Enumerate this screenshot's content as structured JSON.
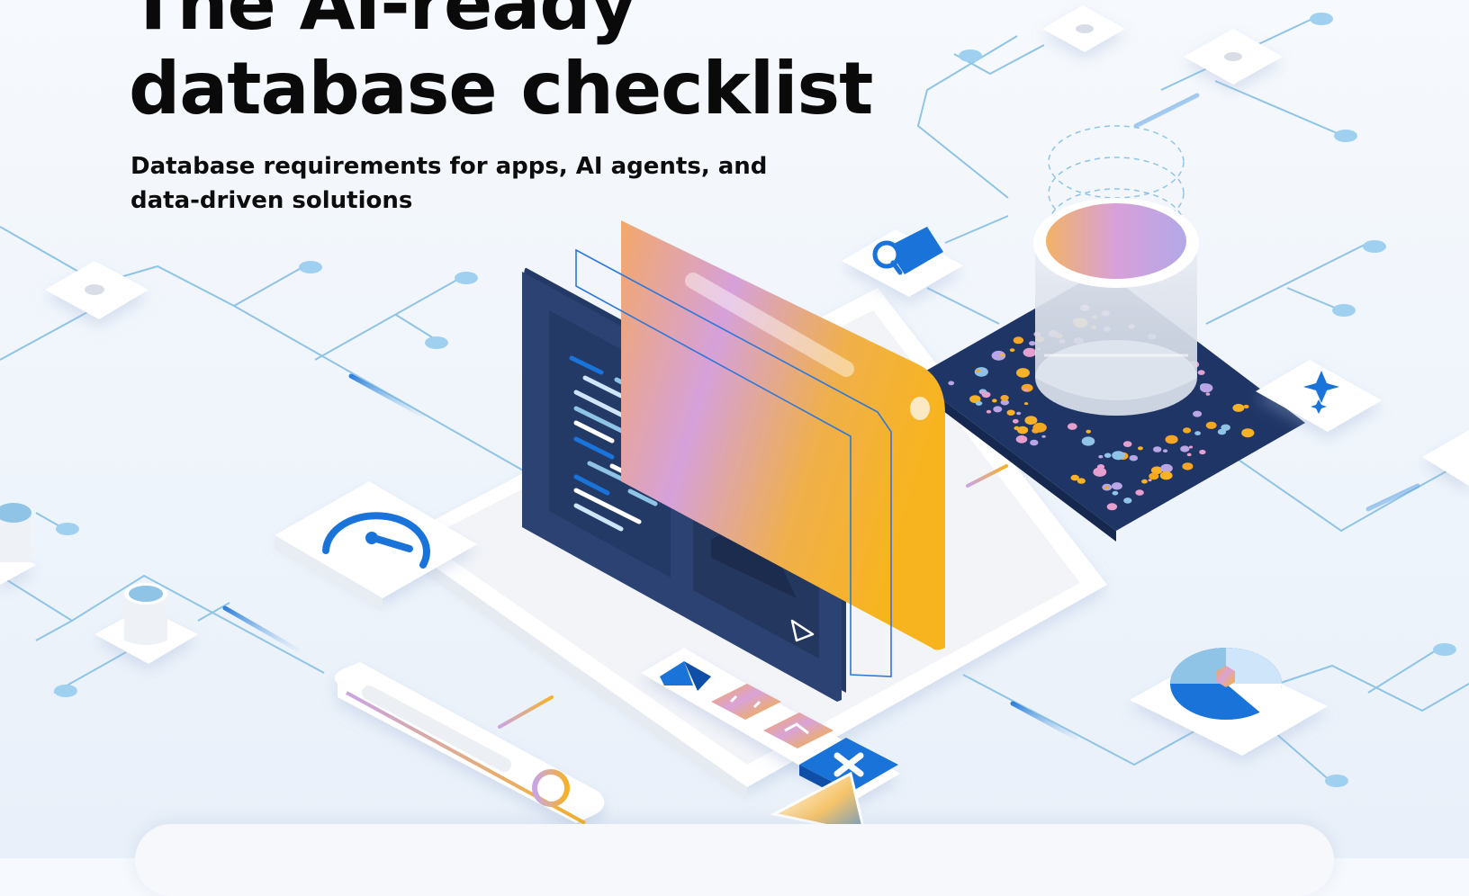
{
  "hero": {
    "title_line1": "The AI-ready",
    "title_line2": "database checklist",
    "subtitle_line1": "Database requirements for apps, AI agents, and",
    "subtitle_line2": "data-driven solutions"
  },
  "colors": {
    "accent_blue": "#1a73d9",
    "line_blue": "#8fc4e6",
    "navy_panel": "#2a3f6a",
    "gradient_orange": "#f5a623",
    "gradient_pink": "#e6a0cf",
    "gradient_lavender": "#b9a6e6"
  },
  "icons": [
    "speedometer-icon",
    "database-cylinder-icon",
    "search-magnifier-icon",
    "camera-search-icon",
    "sparkle-icon",
    "azure-logo-icon",
    "expand-icon",
    "analytics-icon",
    "close-icon",
    "cursor-pointer-icon",
    "pie-chart-icon",
    "image-placeholder-icon"
  ]
}
